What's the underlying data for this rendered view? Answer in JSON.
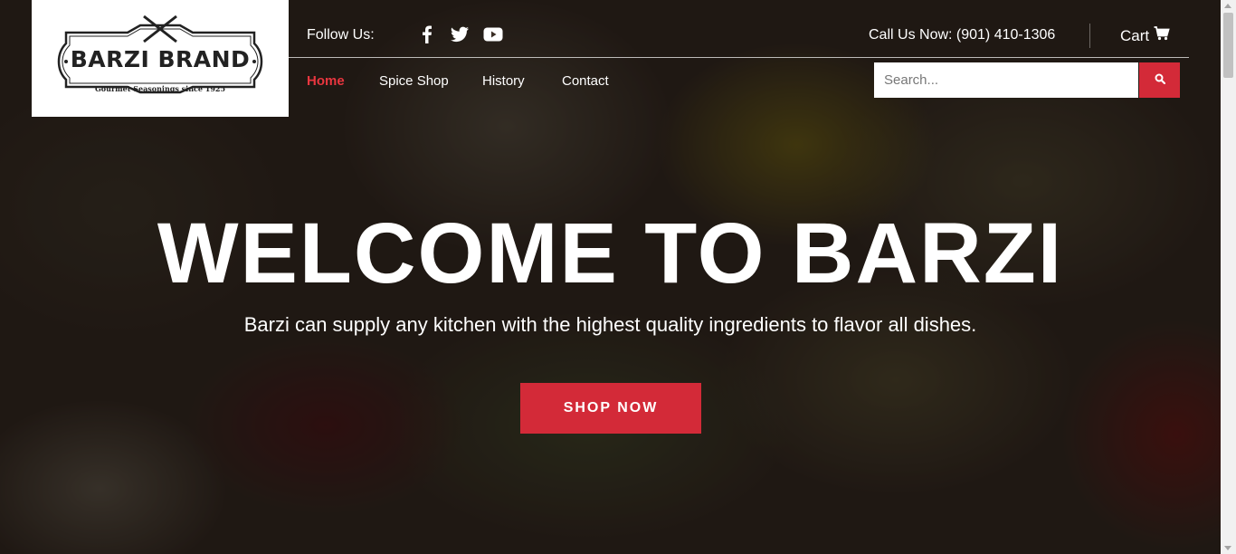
{
  "brand": {
    "name": "BARZI BRAND",
    "tagline": "Gourmet Seasonings since 1925"
  },
  "topbar": {
    "follow_label": "Follow Us:",
    "social": [
      "facebook-icon",
      "twitter-icon",
      "youtube-icon"
    ],
    "call_text": "Call Us Now: (901) 410-1306",
    "cart_label": "Cart"
  },
  "nav": {
    "items": [
      {
        "label": "Home",
        "active": true
      },
      {
        "label": "Spice Shop",
        "active": false
      },
      {
        "label": "History",
        "active": false
      },
      {
        "label": "Contact",
        "active": false
      }
    ]
  },
  "search": {
    "placeholder": "Search...",
    "value": ""
  },
  "hero": {
    "title": "WELCOME TO BARZI",
    "subtitle": "Barzi can supply any kitchen with the highest quality ingredients to flavor all dishes.",
    "cta_label": "SHOP NOW"
  },
  "colors": {
    "accent": "#d32a38",
    "nav_active": "#e8363f",
    "text": "#ffffff"
  }
}
